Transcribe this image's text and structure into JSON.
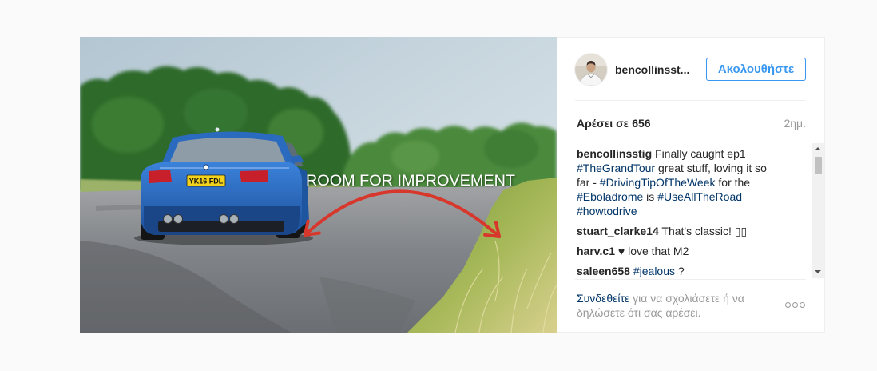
{
  "post": {
    "image": {
      "overlay_text": "ROOM FOR IMPROVEMENT",
      "plate_text": "YK16 FDL"
    },
    "header": {
      "avatar_icon": "profile-avatar",
      "username": "bencollinsst...",
      "follow_label": "Ακολουθήστε"
    },
    "likes": {
      "label": "Αρέσει σε 656",
      "time": "2ημ."
    },
    "comments": [
      {
        "user": "bencollinsstig",
        "parts": [
          "Finally caught ep1",
          "#TheGrandTour",
          "great stuff, loving it so far -",
          "#DrivingTipOfTheWeek",
          "for the",
          "#Eboladrome",
          "is",
          "#UseAllTheRoad",
          "#howtodrive"
        ]
      },
      {
        "user": "stuart_clarke14",
        "parts": [
          "That's classic! ▯▯"
        ]
      },
      {
        "user": "harv.c1",
        "parts": [
          "♥ love that M2"
        ]
      },
      {
        "user": "saleen658",
        "parts": [
          "#jealous",
          "?"
        ]
      }
    ],
    "footer": {
      "login_link": "Συνδεθείτε",
      "login_text": "για να σχολιάσετε ή να δηλώσετε ότι σας αρέσει.",
      "more_icon": "more-options-icon"
    }
  },
  "colors": {
    "page_background": "#fafafa",
    "panel_background": "#ffffff",
    "border": "#efefef",
    "primary_text": "#262626",
    "muted_text": "#999999",
    "link": "#003569",
    "follow_button": "#3897f0",
    "overlay_arrow": "#d8372c"
  }
}
